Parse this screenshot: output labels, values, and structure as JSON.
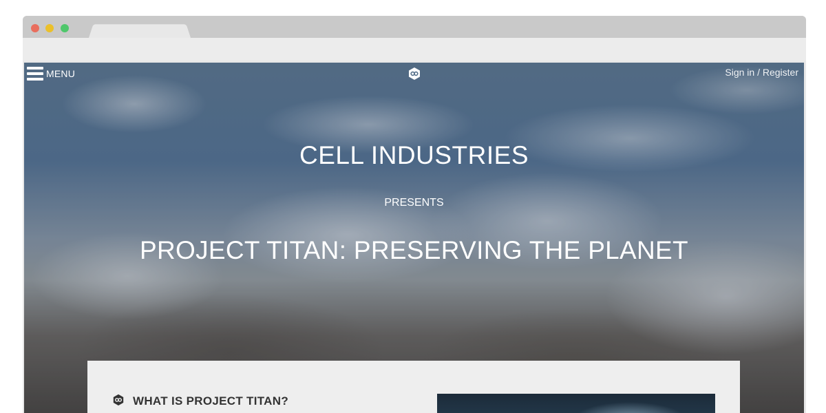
{
  "browser": {
    "window_controls": [
      "close",
      "minimize",
      "maximize"
    ],
    "colors": {
      "close": "#e96e5d",
      "minimize": "#ebc02a",
      "maximize": "#4fc76b"
    }
  },
  "nav": {
    "menu_label": "MENU",
    "menu_icon": "hamburger-icon",
    "logo_icon": "cell-logo-icon",
    "signin_label": "Sign in / Register"
  },
  "hero": {
    "company": "CELL INDUSTRIES",
    "presents": "PRESENTS",
    "project_title": "PROJECT TITAN: PRESERVING THE PLANET"
  },
  "section": {
    "heading": "WHAT IS PROJECT TITAN?",
    "icon": "cell-logo-icon"
  }
}
